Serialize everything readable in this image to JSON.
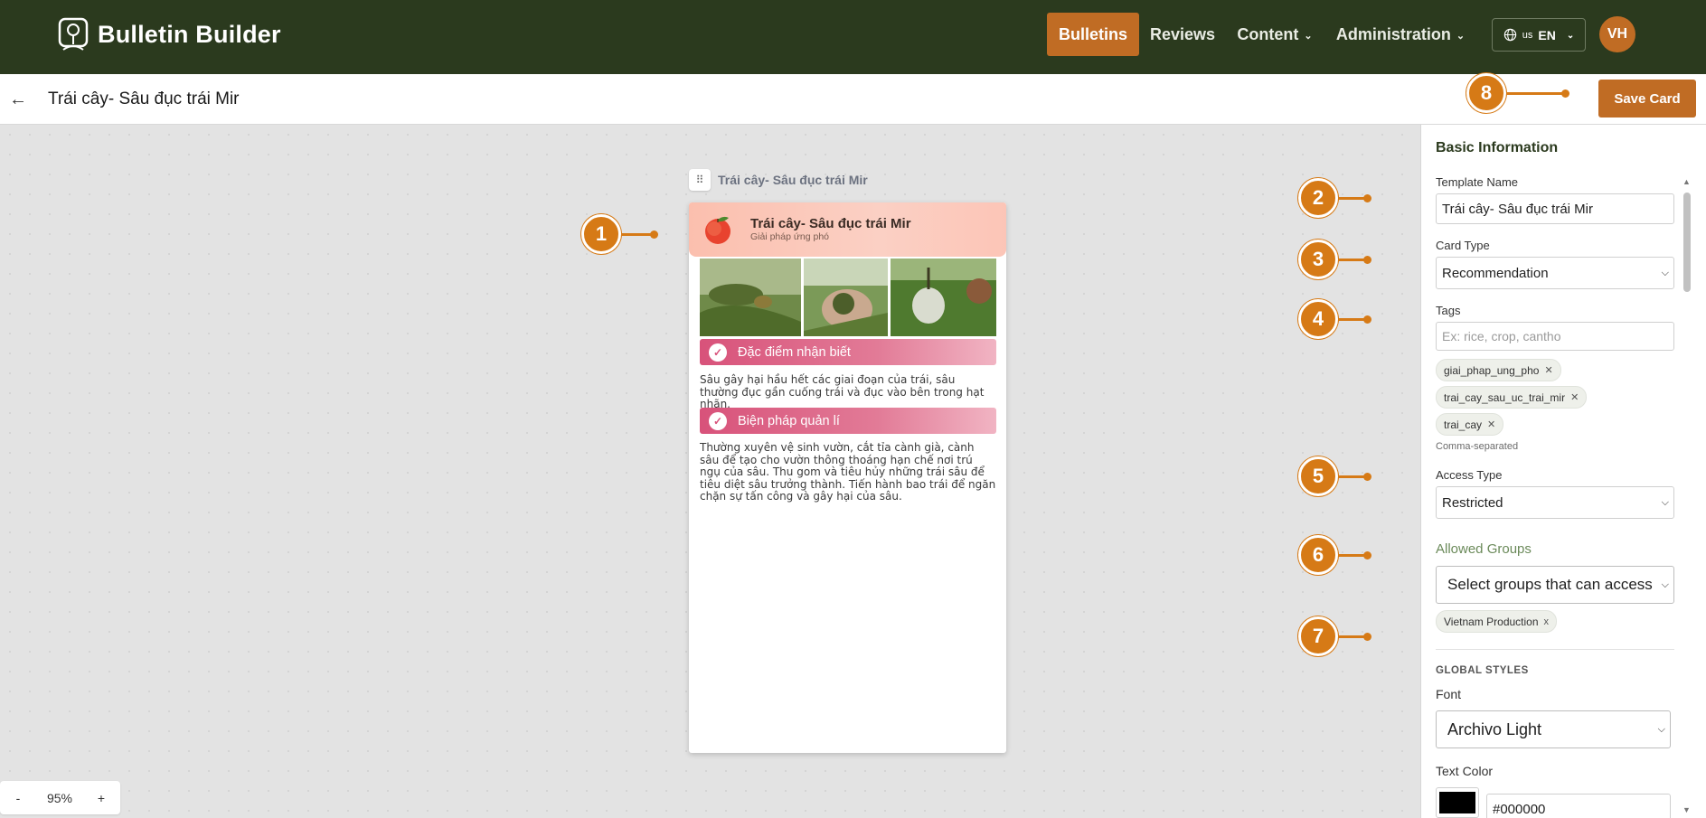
{
  "app": {
    "name": "Bulletin Builder"
  },
  "nav": {
    "items": [
      {
        "label": "Bulletins",
        "active": true
      },
      {
        "label": "Reviews"
      },
      {
        "label": "Content"
      },
      {
        "label": "Administration"
      }
    ],
    "lang_flag": "us",
    "lang_code": "EN",
    "avatar_initials": "VH"
  },
  "header": {
    "title": "Trái cây- Sâu đục trái Mir",
    "save_label": "Save Card"
  },
  "canvas": {
    "card_label": "Trái cây- Sâu đục trái Mir",
    "zoom_minus": "-",
    "zoom_level": "95%",
    "zoom_plus": "+"
  },
  "card": {
    "title": "Trái cây- Sâu đục trái Mir",
    "subtitle": "Giải pháp ứng phó",
    "sections": [
      {
        "heading": "Đặc điểm nhận biết",
        "text": "Sâu gây hại hầu hết các giai đoạn của trái, sâu thường đục gần cuống trái và đục vào bên trong hạt nhãn."
      },
      {
        "heading": "Biện pháp quản lí",
        "text": "Thường xuyên vệ sinh vườn, cắt tỉa cành già, cành sâu để tạo cho vườn thông thoáng hạn chế nơi trú ngụ của sâu. Thu gom và tiêu hủy những trái sâu để tiêu diệt sâu trưởng thành. Tiến hành bao trái để ngăn chặn sự tấn công và gây hại của sâu."
      }
    ]
  },
  "markers": [
    "1",
    "2",
    "3",
    "4",
    "5",
    "6",
    "7",
    "8"
  ],
  "panel": {
    "heading": "Basic Information",
    "template_name_label": "Template Name",
    "template_name_value": "Trái cây- Sâu đục trái Mir",
    "card_type_label": "Card Type",
    "card_type_value": "Recommendation",
    "tags_label": "Tags",
    "tags_placeholder": "Ex: rice, crop, cantho",
    "tags": [
      "giai_phap_ung_pho",
      "trai_cay_sau_uc_trai_mir",
      "trai_cay"
    ],
    "tags_hint": "Comma-separated",
    "access_type_label": "Access Type",
    "access_type_value": "Restricted",
    "allowed_groups_label": "Allowed Groups",
    "allowed_groups_placeholder": "Select groups that can access",
    "groups": [
      "Vietnam Production"
    ],
    "global_styles_label": "GLOBAL STYLES",
    "font_label": "Font",
    "font_value": "Archivo Light",
    "text_color_label": "Text Color",
    "text_color_value": "#000000"
  },
  "colors": {
    "nav_bg": "#2b3a1e",
    "accent": "#c06c24",
    "marker": "#d67a16",
    "section_bar": "#d8527a"
  },
  "icons": {
    "logo": "tree-badge-icon",
    "back": "arrow-left-icon",
    "globe": "globe-icon",
    "drag": "drag-handle-icon",
    "peach": "peach-icon",
    "check": "check-circle-icon"
  }
}
